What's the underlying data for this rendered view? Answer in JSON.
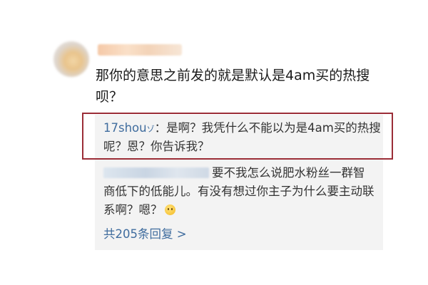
{
  "comment": {
    "text": "那你的意思之前发的就是默认是4am买的热搜呗？"
  },
  "replies": [
    {
      "user": "17shou",
      "user_suffix": "ゾ",
      "separator": "：",
      "text": "是啊？我凭什么不能以为是4am买的热搜呢？恩？你告诉我？"
    },
    {
      "text": "要不我怎么说肥水粉丝一群智商低下的低能儿。有没有想过你主子为什么要主动联系啊？嗯？",
      "emoji": "smiley-emoji"
    }
  ],
  "more_replies": {
    "label": "共205条回复 >"
  },
  "colors": {
    "highlight_border": "#9b2d37",
    "link": "#3f6c9e",
    "reply_bg": "#f3f3f3"
  }
}
